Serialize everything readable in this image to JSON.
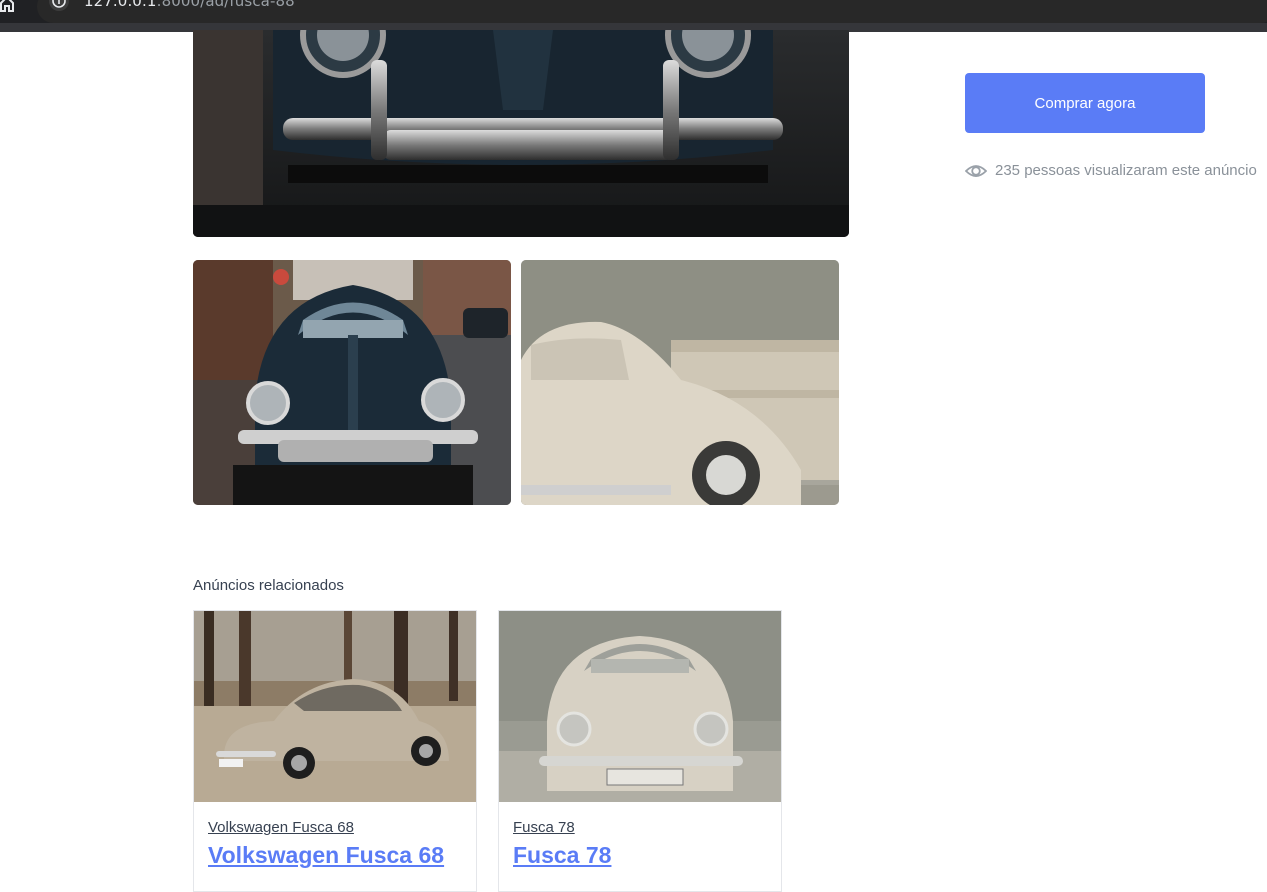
{
  "browser": {
    "url_host": "127.0.0.1",
    "url_path": ":8000/ad/fusca-88"
  },
  "listing": {
    "buy_button_label": "Comprar agora",
    "views_text": "235 pessoas visualizaram este anúncio"
  },
  "related": {
    "title": "Anúncios relacionados",
    "items": [
      {
        "subtitle": "Volkswagen Fusca 68",
        "title": "Volkswagen Fusca 68"
      },
      {
        "subtitle": "Fusca 78",
        "title": "Fusca 78"
      }
    ]
  },
  "colors": {
    "accent": "#5a7cf6",
    "browser_bar": "#202124",
    "text_muted": "#8a9199"
  },
  "icons": [
    "home-icon",
    "info-icon",
    "eye-icon"
  ]
}
